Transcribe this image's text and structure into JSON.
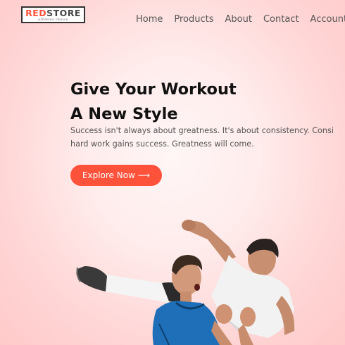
{
  "brand": {
    "logo_red": "RED",
    "logo_dark": "STORE",
    "tagline": "athletes choice"
  },
  "nav": {
    "items": [
      {
        "label": "Home"
      },
      {
        "label": "Products"
      },
      {
        "label": "About"
      },
      {
        "label": "Contact"
      },
      {
        "label": "Account"
      }
    ]
  },
  "hero": {
    "title_line1": "Give Your Workout",
    "title_line2": "A New Style",
    "subtitle_line1": "Success isn't always about greatness. It's about consistency. Consi",
    "subtitle_line2": "hard work gains success. Greatness will come.",
    "cta_label": "Explore Now",
    "cta_arrow": "⟶"
  },
  "colors": {
    "accent": "#ff523b",
    "heading": "#111111",
    "text": "#555555"
  }
}
